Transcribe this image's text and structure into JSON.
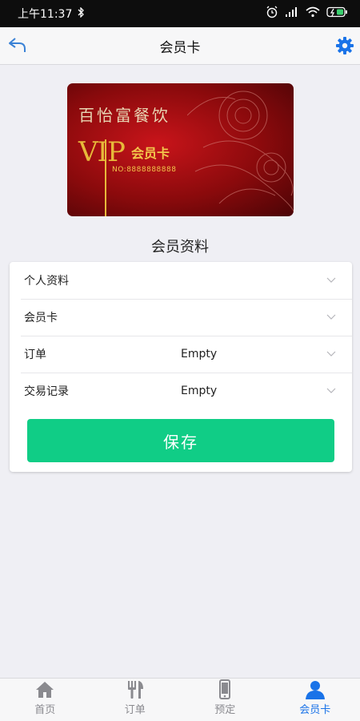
{
  "status_bar": {
    "time": "上午11:37"
  },
  "nav": {
    "title": "会员卡"
  },
  "card": {
    "brand": "百怡富餐饮",
    "vip_text": "VIP",
    "member_label": "会员卡",
    "number_label": "NO:8888888888"
  },
  "section_title": "会员资料",
  "rows": [
    {
      "label": "个人资料",
      "value": ""
    },
    {
      "label": "会员卡",
      "value": ""
    },
    {
      "label": "订单",
      "value": "Empty"
    },
    {
      "label": "交易记录",
      "value": "Empty"
    }
  ],
  "save_label": "保存",
  "tabs": [
    {
      "label": "首页",
      "icon": "home-icon",
      "active": false
    },
    {
      "label": "订单",
      "icon": "fork-knife-icon",
      "active": false
    },
    {
      "label": "预定",
      "icon": "phone-icon",
      "active": false
    },
    {
      "label": "会员卡",
      "icon": "user-icon",
      "active": true
    }
  ],
  "colors": {
    "accent": "#1a73e8",
    "save_button": "#10cd86",
    "card_red": "#c8141a",
    "card_gold": "#e7b93a"
  }
}
